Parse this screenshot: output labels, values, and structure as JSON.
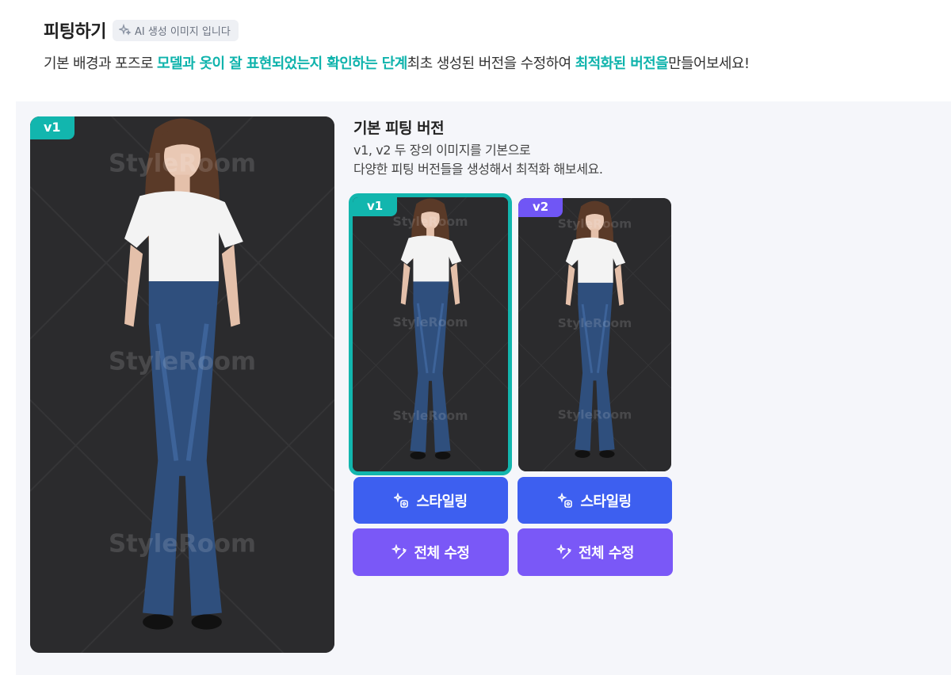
{
  "header": {
    "title": "피팅하기",
    "ai_badge": "AI 생성 이미지 입니다"
  },
  "description": {
    "part1": "기본 배경과 포즈로 ",
    "highlight1": "모델과 옷이 잘 표현되었는지 확인하는 단계",
    "part2": "최초 생성된 버전을 수정하여 ",
    "highlight2": "최적화된 버전을",
    "part3": "만들어보세요!"
  },
  "main_preview": {
    "version_label": "v1",
    "watermark": "StyleRoom"
  },
  "section": {
    "title": "기본 피팅 버전",
    "desc_line1": "v1, v2 두 장의 이미지를 기본으로",
    "desc_line2": "다양한 피팅 버전들을 생성해서 최적화 해보세요."
  },
  "versions": [
    {
      "label": "v1",
      "selected": true,
      "styling_label": "스타일링",
      "edit_label": "전체 수정"
    },
    {
      "label": "v2",
      "selected": false,
      "styling_label": "스타일링",
      "edit_label": "전체 수정"
    }
  ],
  "colors": {
    "accent_teal": "#12b6ae",
    "styling_blue": "#3d5ff0",
    "edit_purple": "#7a58f7",
    "v2_purple": "#7056f5"
  },
  "icons": {
    "ai_badge": "sparkle-icon",
    "styling": "magic-sparkle-icon",
    "edit": "magic-wand-icon"
  }
}
